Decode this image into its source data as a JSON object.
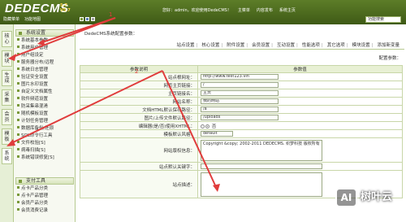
{
  "header": {
    "logo": "DEDECMS",
    "version": "5.7 V5.7",
    "left_links": [
      "隐藏菜单",
      "功能地图"
    ],
    "right_links": [
      "您好：admin，欢迎使用DedeCMS！",
      "主菜单",
      "内容发布",
      "系统主页"
    ],
    "search_value": "功能搜索"
  },
  "vtabs": [
    "核心",
    "模块",
    "生成",
    "采集",
    "会员",
    "模板",
    "系统"
  ],
  "sidebar": {
    "section1_title": "系统设置",
    "section1_items": [
      "系统基本参数",
      "系统用户管理",
      "用户组设定",
      "服务器分布/远程",
      "系统日志管理",
      "验证安全设置",
      "图片水印设置",
      "自定义文档属性",
      "软件频道设置",
      "防采集串混淆",
      "随机模板设置",
      "计划任务管理",
      "数据库备份/还原",
      "SQL命令行工具",
      "文件校验[S]",
      "病毒扫描[S]",
      "系统错误修复[S]"
    ],
    "section2_title": "支付工具",
    "section2_items": [
      "点卡产品分类",
      "点卡产品管理",
      "会员产品分类",
      "会员消费记录"
    ]
  },
  "main": {
    "title": "DedeCMS系统配置参数：",
    "tabs": [
      "站点设置",
      "核心设置",
      "附件设置",
      "会员设置",
      "互动设置",
      "性能选项",
      "其它选项",
      "模块设置",
      "添加新变量"
    ],
    "var_label": "配置参数：",
    "table_headers": [
      "参数说明",
      "参数值"
    ],
    "rows": [
      {
        "label": "站点根网址：",
        "value": "http://www.test123.vin"
      },
      {
        "label": "网页主页链接：",
        "value": "/"
      },
      {
        "label": "主页链接名：",
        "value": "主页"
      },
      {
        "label": "网站名称：",
        "value": "我的网站"
      },
      {
        "label": "文档HTML默认保存路径：",
        "value": "/a"
      },
      {
        "label": "图片/上传文件默认路径：",
        "value": "/uploads"
      },
      {
        "label": "编辑器(是/否)使用XHTML：",
        "value": "否"
      },
      {
        "label": "模板默认风格：",
        "value": "default"
      },
      {
        "label": "网站版权信息：",
        "value": "Copyright &copy; 2002-2011 DEDECMS. 织梦科技 版权所有"
      },
      {
        "label": "站点默认关键字：",
        "value": ""
      },
      {
        "label": "站点描述：",
        "value": ""
      }
    ]
  },
  "annotations": {
    "marker_1": "1",
    "marker_2": "2",
    "arrow_color": "#e03c3c"
  },
  "watermark": {
    "badge": "AI",
    "text": "树叶云"
  }
}
